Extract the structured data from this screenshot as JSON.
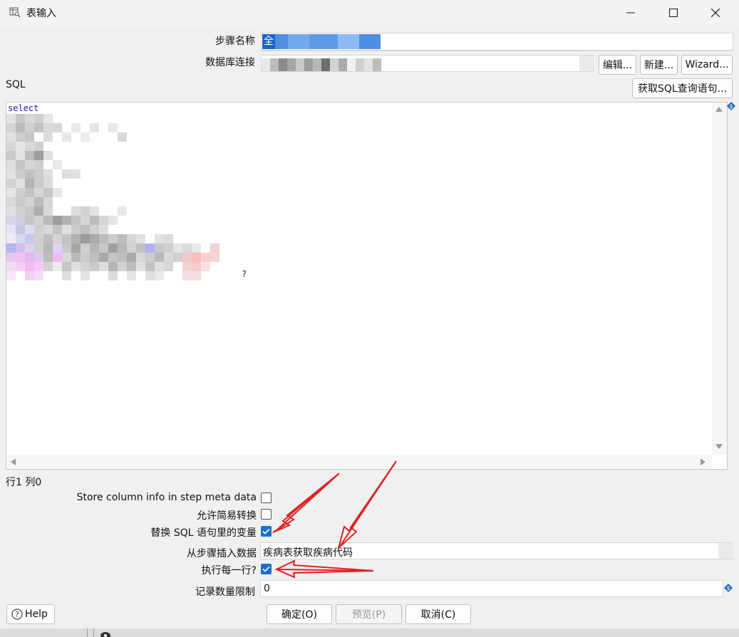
{
  "window": {
    "title": "表输入",
    "icon": "table-input-icon",
    "minimize_icon": "minimize-icon",
    "maximize_icon": "maximize-icon",
    "close_icon": "close-icon"
  },
  "form": {
    "step_name_label": "步骤名称",
    "step_name_value": "全",
    "db_connection_label": "数据库连接",
    "edit_button": "编辑...",
    "new_button": "新建...",
    "wizard_button": "Wizard...",
    "sql_label": "SQL",
    "get_sql_button": "获取SQL查询语句...",
    "sql_first_line": "select",
    "sql_question_mark": "?",
    "cursor_position": "行1 列0"
  },
  "options": {
    "store_column_info_label": "Store column info in step meta data",
    "store_column_info_checked": false,
    "lazy_conversion_label": "允许简易转换",
    "lazy_conversion_checked": false,
    "replace_variables_label": "替换 SQL 语句里的变量",
    "replace_variables_checked": true,
    "insert_from_step_label": "从步骤插入数据",
    "insert_from_step_value": "疾病表获取疾病代码",
    "execute_each_row_label": "执行每一行?",
    "execute_each_row_checked": true,
    "limit_label": "记录数量限制",
    "limit_value": "0"
  },
  "footer": {
    "help_button": "Help",
    "ok_button": "确定(O)",
    "preview_button": "预览(P)",
    "cancel_button": "取消(C)"
  },
  "colors": {
    "accent": "#1f6dc6",
    "annotation_arrow": "#e02020",
    "sql_keyword": "#1a1ab0"
  }
}
